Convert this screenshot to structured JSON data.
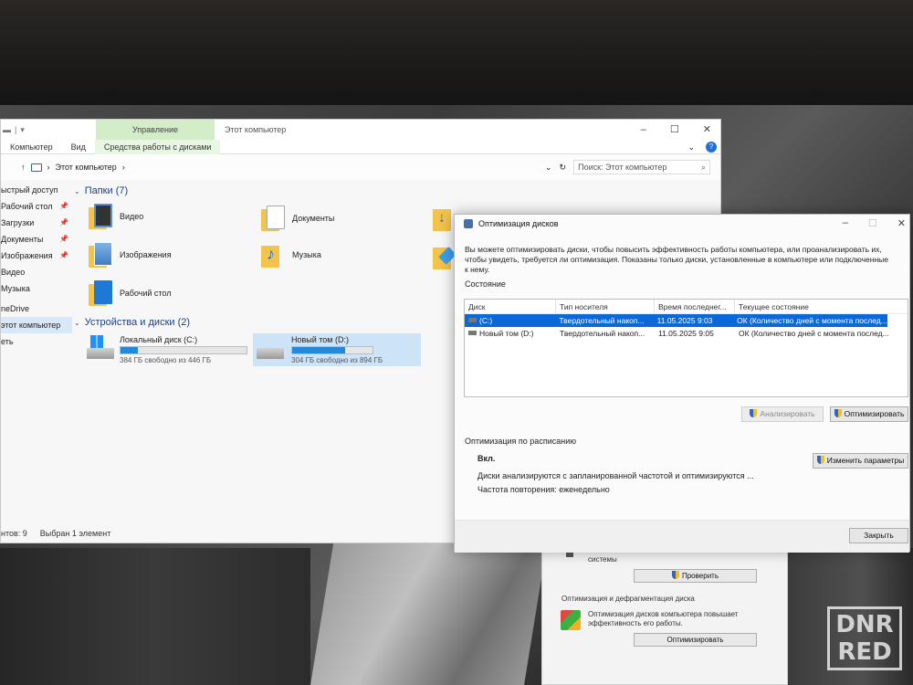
{
  "explorer": {
    "ribbon_context_tab": "Управление",
    "window_title": "Этот компьютер",
    "tabs": [
      "Компьютер",
      "Вид",
      "Средства работы с дисками"
    ],
    "breadcrumb": "Этот компьютер",
    "search_placeholder": "Поиск: Этот компьютер",
    "nav": [
      {
        "label": "ыстрый доступ",
        "pinned": false
      },
      {
        "label": "Рабочий стол",
        "pinned": true
      },
      {
        "label": "Загрузки",
        "pinned": true
      },
      {
        "label": "Документы",
        "pinned": true
      },
      {
        "label": "Изображения",
        "pinned": true
      },
      {
        "label": "Видео",
        "pinned": false
      },
      {
        "label": "Музыка",
        "pinned": false
      },
      {
        "label": "neDrive",
        "pinned": false
      },
      {
        "label": "этот компьютер",
        "pinned": false
      },
      {
        "label": "еть",
        "pinned": false
      }
    ],
    "folders_header": "Папки (7)",
    "folders": [
      "Видео",
      "Документы",
      "Изображения",
      "Музыка",
      "Рабочий стол"
    ],
    "devices_header": "Устройства и диски (2)",
    "drives": [
      {
        "name": "Локальный диск (C:)",
        "free": "384 ГБ свободно из 446 ГБ",
        "used_fraction": 0.14
      },
      {
        "name": "Новый том (D:)",
        "free": "304 ГБ свободно из 894 ГБ",
        "used_fraction": 0.66
      }
    ],
    "status_items": "нтов: 9",
    "status_selected": "Выбран 1 элемент"
  },
  "optimize": {
    "title": "Оптимизация дисков",
    "description": "Вы можете оптимизировать диски, чтобы повысить эффективность работы  компьютера, или проанализировать их, чтобы увидеть, требуется ли оптимизация. Показаны только диски, установленные в компьютере или подключенные к нему.",
    "status_label": "Состояние",
    "columns": [
      "Диск",
      "Тип носителя",
      "Время последнег...",
      "Текущее состояние"
    ],
    "rows": [
      [
        "(C:)",
        "Твердотельный накоп...",
        "11.05.2025 9:03",
        "ОК (Количество дней с момента послед..."
      ],
      [
        "Новый том (D:)",
        "Твердотельный накоп...",
        "11.05.2025 9:05",
        "ОК (Количество дней с момента послед..."
      ]
    ],
    "analyze_button": "Анализировать",
    "optimize_button": "Оптимизировать",
    "schedule_label": "Оптимизация по расписанию",
    "schedule_state": "Вкл.",
    "schedule_desc": "Диски анализируются с запланированной частотой и оптимизируются ...",
    "schedule_freq": "Частота повторения: еженедельно",
    "change_settings_button": "Изменить параметры",
    "close_button": "Закрыть"
  },
  "backwindow": {
    "text1": "системы",
    "check_button": "Проверить",
    "section": "Оптимизация и дефрагментация диска",
    "desc1": "Оптимизация дисков компьютера повышает",
    "desc2": "эффективность его работы.",
    "optimize_button": "Оптимизировать"
  },
  "watermark": [
    "DNR",
    "RED"
  ]
}
